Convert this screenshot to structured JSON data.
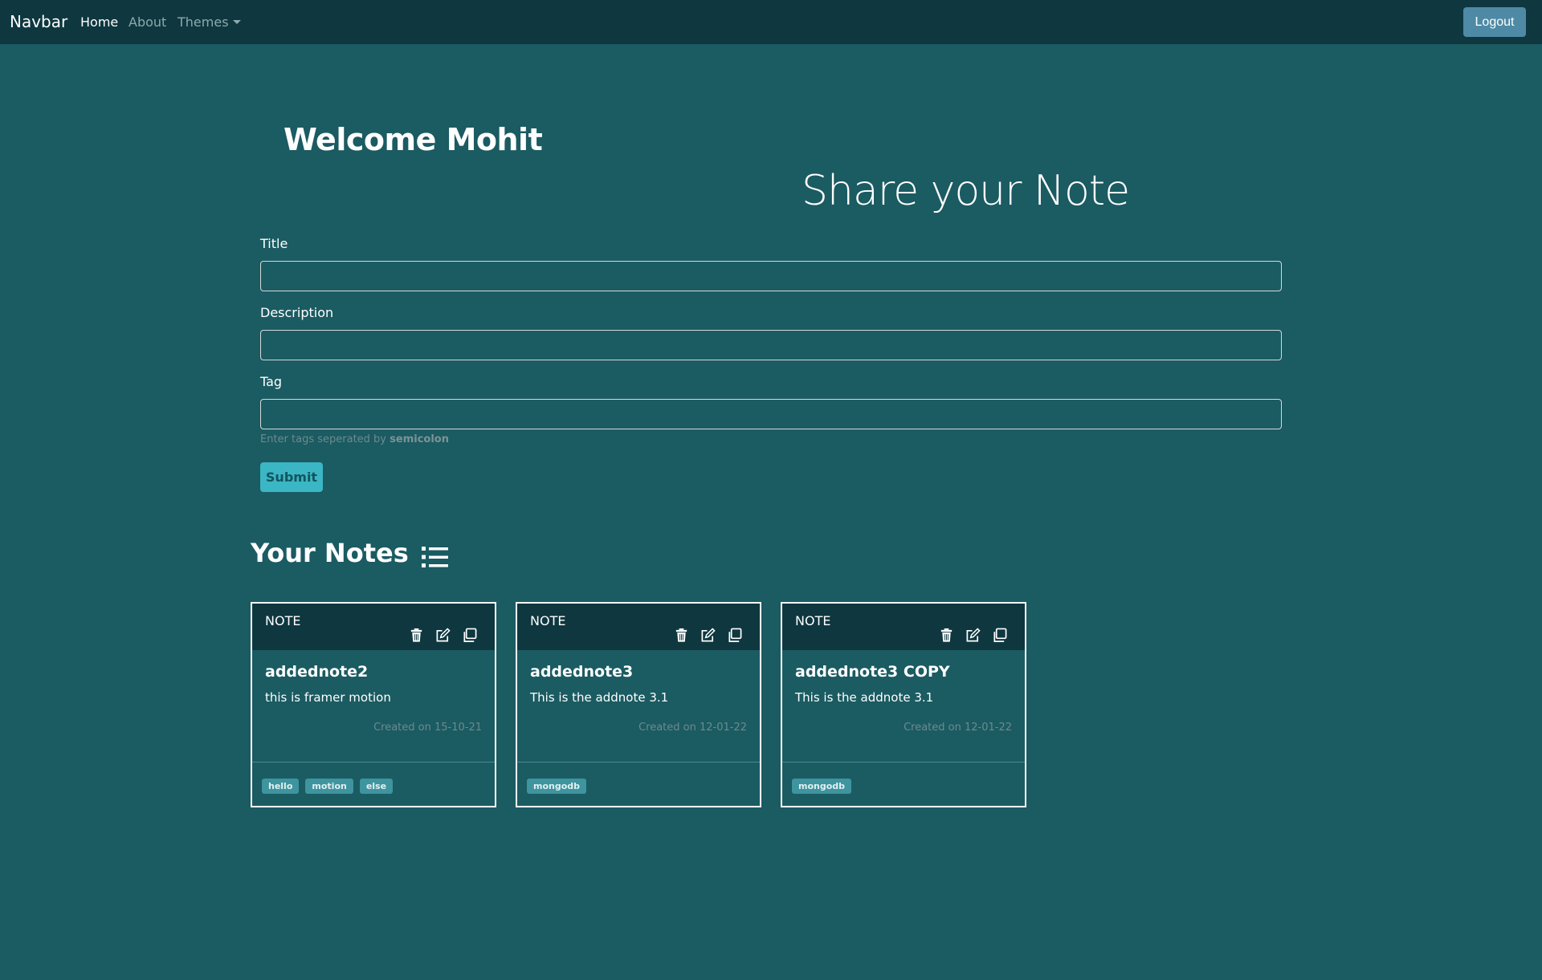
{
  "navbar": {
    "brand": "Navbar",
    "links": [
      {
        "label": "Home",
        "active": true
      },
      {
        "label": "About",
        "active": false
      },
      {
        "label": "Themes",
        "dropdown": true
      }
    ],
    "logout_label": "Logout"
  },
  "welcome": "Welcome Mohit",
  "form": {
    "heading": "Share your Note",
    "title_label": "Title",
    "title_value": "",
    "description_label": "Description",
    "description_value": "",
    "tag_label": "Tag",
    "tag_value": "",
    "help_text": "Enter tags seperated by ",
    "help_bold": "semicolon",
    "submit_label": "Submit"
  },
  "notes_section": {
    "heading": "Your Notes",
    "icon": "list-icon",
    "notes": [
      {
        "header": "NOTE",
        "title": "addednote2",
        "description": "this is framer motion",
        "created": "Created on 15-10-21",
        "tags": [
          "hello",
          "motion",
          "else"
        ]
      },
      {
        "header": "NOTE",
        "title": "addednote3",
        "description": "This is the addnote 3.1",
        "created": "Created on 12-01-22",
        "tags": [
          "mongodb"
        ]
      },
      {
        "header": "NOTE",
        "title": "addednote3 COPY",
        "description": "This is the addnote 3.1",
        "created": "Created on 12-01-22",
        "tags": [
          "mongodb"
        ]
      }
    ]
  },
  "colors": {
    "background": "#1b5b62",
    "navbar": "#0e373f",
    "logout": "#4e8aa5",
    "submit": "#3bb6c4",
    "tag": "#3e949f"
  }
}
